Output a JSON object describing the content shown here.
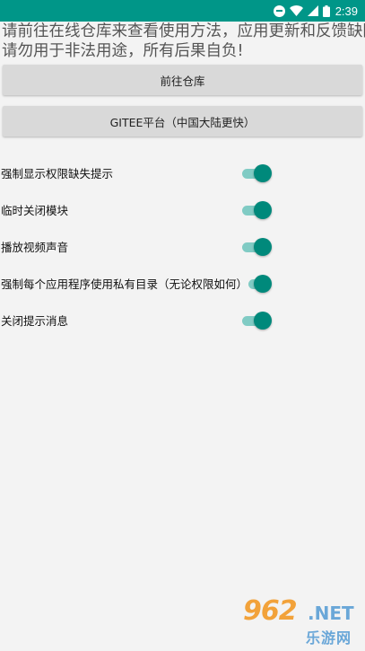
{
  "status_bar": {
    "time": "2:39",
    "icons": [
      "do-not-disturb-icon",
      "wifi-icon",
      "signal-icon",
      "battery-icon"
    ]
  },
  "notice": {
    "line1": "请前往在线仓库来查看使用方法，应用更新和反馈缺陷",
    "line2": "请勿用于非法用途，所有后果自负!"
  },
  "buttons": {
    "repo": "前往仓库",
    "gitee": "GITEE平台（中国大陆更快）"
  },
  "settings": [
    {
      "label": "强制显示权限缺失提示",
      "enabled": true
    },
    {
      "label": "临时关闭模块",
      "enabled": true
    },
    {
      "label": "播放视频声音",
      "enabled": true
    },
    {
      "label": "强制每个应用程序使用私有目录（无论权限如何）",
      "enabled": true
    },
    {
      "label": "关闭提示消息",
      "enabled": true
    }
  ],
  "watermark": {
    "brand_number": "962",
    "brand_suffix": ".NET",
    "brand_cn": "乐游网"
  },
  "colors": {
    "accent": "#009688",
    "switch_thumb": "#00897b",
    "switch_track": "#80cbc4",
    "button_bg": "#d9d9d9",
    "background": "#f3f3f3"
  }
}
